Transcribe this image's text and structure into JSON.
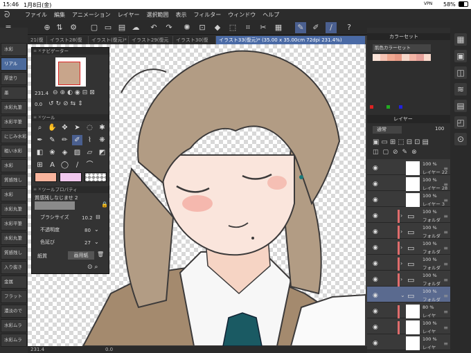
{
  "status": {
    "time": "15:46",
    "date": "1月8日(金)",
    "battery": "58%",
    "vpn": "VPN"
  },
  "menu": [
    "ファイル",
    "編集",
    "アニメーション",
    "レイヤー",
    "選択範囲",
    "表示",
    "フィルター",
    "ウィンドウ",
    "ヘルプ"
  ],
  "tabs": [
    "21(復",
    "イラスト28(復",
    "イラスト(復元)*",
    "イラスト29(復元",
    "イラスト30(復",
    "イラスト33(復元)* (35.00 x 35.00cm 72dpi 231.4%)"
  ],
  "left_tools": [
    "水彩",
    "リアル",
    "厚塗り",
    "墨",
    "水彩丸筆",
    "水彩平筆",
    "にじみ水彩",
    "粗い水彩",
    "水彩",
    "質感残し",
    "水彩",
    "水彩丸筆",
    "水彩平筆",
    "水彩丸筆",
    "質感残し",
    "入り抜き",
    "金属",
    "フラット",
    "濃淡ので",
    "水彩ムラ",
    "水彩ムラ"
  ],
  "navigator": {
    "title": "ナビゲーター",
    "zoom": "231.4",
    "rotation": "0.0"
  },
  "tool_panel": {
    "title": "ツール"
  },
  "tool_property": {
    "title": "ツールプロパティ",
    "tool_name": "質感残しなじませ 2",
    "brush_size_label": "ブラシサイズ",
    "brush_size": "10.2",
    "opacity_label": "不透明度",
    "opacity": "80",
    "color_stretch_label": "色延び",
    "color_stretch": "27",
    "paper_label": "紙質",
    "paper_value": "画用紙"
  },
  "colorset": {
    "title": "カラーセット",
    "set_name": "肌色カラーセット",
    "swatches": [
      "#fbe3d8",
      "#f7c3b3",
      "#f0a891",
      "#e89a86",
      "#f6d6c8",
      "#f3b4a5",
      "#e6a19a",
      "#f9d9cc"
    ]
  },
  "layer_panel": {
    "title": "レイヤー",
    "blend_mode": "通常",
    "opacity": "100",
    "layers": [
      {
        "pct": "100 %",
        "name": "レイヤー 22",
        "type": "raster",
        "selected": false,
        "bar": false
      },
      {
        "pct": "100 %",
        "name": "レイヤー 28",
        "type": "raster",
        "selected": false,
        "bar": false
      },
      {
        "pct": "100 %",
        "name": "レイヤー 3",
        "type": "raster",
        "selected": false,
        "bar": false
      },
      {
        "pct": "100 %",
        "name": "フォルダ",
        "type": "folder",
        "selected": false,
        "bar": true
      },
      {
        "pct": "100 %",
        "name": "フォルダ",
        "type": "folder",
        "selected": false,
        "bar": true
      },
      {
        "pct": "100 %",
        "name": "フォルダ",
        "type": "folder",
        "selected": false,
        "bar": true
      },
      {
        "pct": "100 %",
        "name": "フォルダ",
        "type": "folder",
        "selected": false,
        "bar": true
      },
      {
        "pct": "100 %",
        "name": "フォルダ",
        "type": "folder",
        "selected": false,
        "bar": true
      },
      {
        "pct": "100 %",
        "name": "フォルダ",
        "type": "folder",
        "selected": true,
        "bar": false
      },
      {
        "pct": "80 %",
        "name": "レイヤ",
        "type": "raster",
        "selected": false,
        "bar": true
      },
      {
        "pct": "100 %",
        "name": "レイヤ",
        "type": "raster",
        "selected": false,
        "bar": true
      },
      {
        "pct": "100 %",
        "name": "レイヤ",
        "type": "raster",
        "selected": false,
        "bar": false
      }
    ]
  },
  "bottom": {
    "zoom": "231.4",
    "angle": "0.0"
  }
}
